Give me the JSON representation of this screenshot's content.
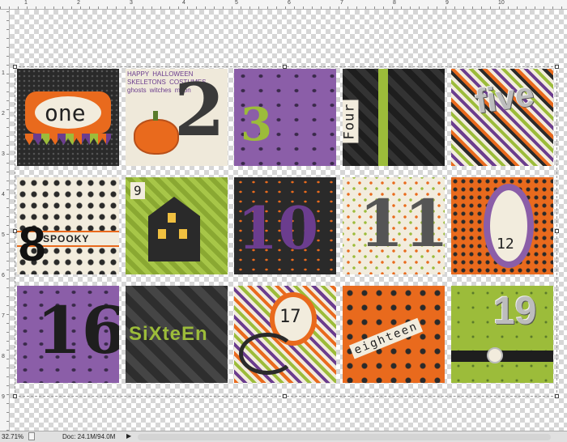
{
  "rulers": {
    "top": [
      "1",
      "2",
      "3",
      "4",
      "5",
      "6",
      "7",
      "8",
      "9",
      "10"
    ],
    "left": [
      "1",
      "2",
      "3",
      "4",
      "5",
      "6",
      "7",
      "8",
      "9"
    ]
  },
  "tiles": [
    {
      "label": "one"
    },
    {
      "label": "2"
    },
    {
      "label": "3"
    },
    {
      "label": "Four"
    },
    {
      "label": "five"
    },
    {
      "label": "8"
    },
    {
      "label": "9"
    },
    {
      "label": "10"
    },
    {
      "label": "11"
    },
    {
      "label": "12"
    },
    {
      "label": "16"
    },
    {
      "label": "SiXteEn"
    },
    {
      "label": "17"
    },
    {
      "label": "eighteen"
    },
    {
      "label": "19"
    }
  ],
  "extra_labels": {
    "spooky": "SPOOKY",
    "paper_words": "HAPPY HALLOWEEN SKELETONS COSTUMES ghosts witches moon"
  },
  "status": {
    "zoom": "32.71%",
    "doc": "Doc: 24.1M/94.0M",
    "arrow": "▶"
  }
}
